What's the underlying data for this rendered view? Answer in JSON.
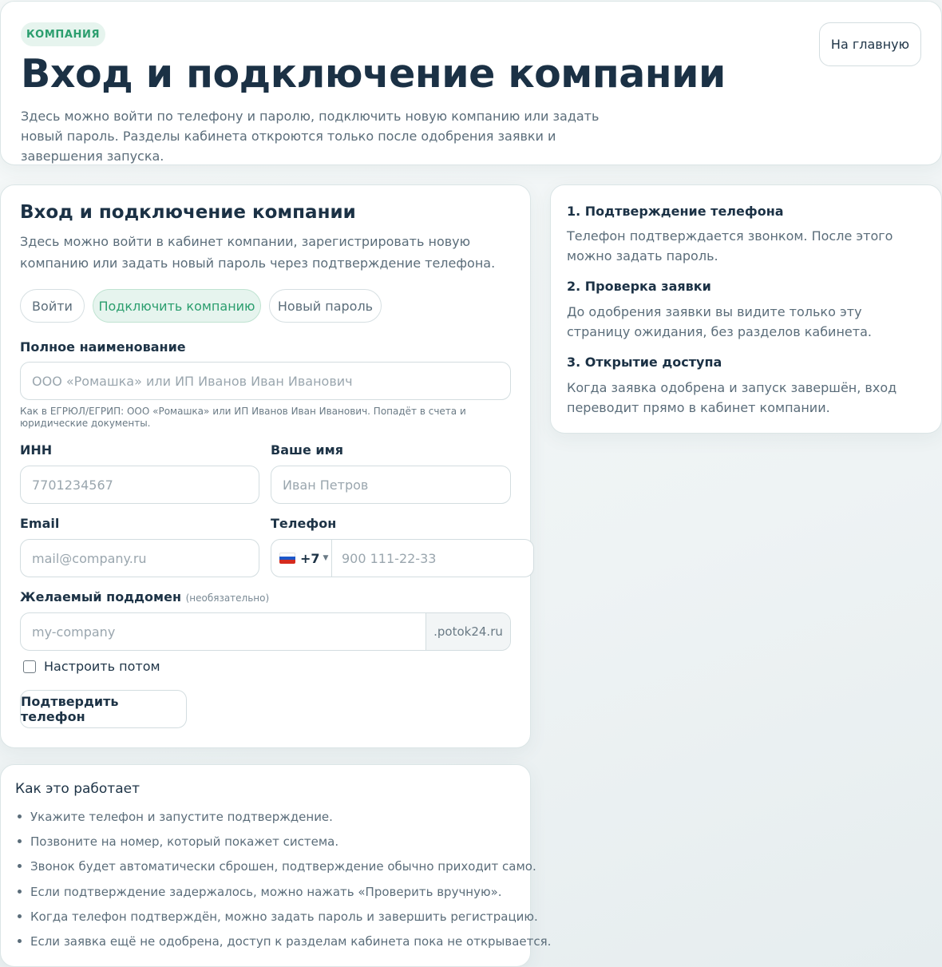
{
  "header": {
    "badge": "КОМПАНИЯ",
    "title": "Вход и подключение компании",
    "description": "Здесь можно войти по телефону и паролю, подключить новую компанию или задать новый пароль. Разделы кабинета откроются только после одобрения заявки и завершения запуска.",
    "home_button": "На главную"
  },
  "form": {
    "title": "Вход и подключение компании",
    "description": "Здесь можно войти в кабинет компании, зарегистрировать новую компанию или задать новый пароль через подтверждение телефона.",
    "tabs": [
      {
        "label": "Войти",
        "active": false
      },
      {
        "label": "Подключить компанию",
        "active": true
      },
      {
        "label": "Новый пароль",
        "active": false
      }
    ],
    "fullname": {
      "label": "Полное наименование",
      "placeholder": "ООО «Ромашка» или ИП Иванов Иван Иванович",
      "hint": "Как в ЕГРЮЛ/ЕГРИП: ООО «Ромашка» или ИП Иванов Иван Иванович. Попадёт в счета и юридические документы."
    },
    "inn": {
      "label": "ИНН",
      "placeholder": "7701234567"
    },
    "name": {
      "label": "Ваше имя",
      "placeholder": "Иван Петров"
    },
    "email": {
      "label": "Email",
      "placeholder": "mail@company.ru"
    },
    "phone": {
      "label": "Телефон",
      "code": "+7",
      "placeholder": "900 111-22-33"
    },
    "subdomain": {
      "label": "Желаемый поддомен",
      "optional": "(необязательно)",
      "placeholder": "my-company",
      "suffix": ".potok24.ru"
    },
    "later_checkbox": {
      "label": "Настроить потом",
      "checked": false
    },
    "submit": "Подтвердить телефон"
  },
  "steps": [
    {
      "title": "1. Подтверждение телефона",
      "text": "Телефон подтверждается звонком. После этого можно задать пароль."
    },
    {
      "title": "2. Проверка заявки",
      "text": "До одобрения заявки вы видите только эту страницу ожидания, без разделов кабинета."
    },
    {
      "title": "3. Открытие доступа",
      "text": "Когда заявка одобрена и запуск завершён, вход переводит прямо в кабинет компании."
    }
  ],
  "how": {
    "title": "Как это работает",
    "items": [
      "Укажите телефон и запустите подтверждение.",
      "Позвоните на номер, который покажет система.",
      "Звонок будет автоматически сброшен, подтверждение обычно приходит само.",
      "Если подтверждение задержалось, можно нажать «Проверить вручную».",
      "Когда телефон подтверждён, можно задать пароль и завершить регистрацию.",
      "Если заявка ещё не одобрена, доступ к разделам кабинета пока не открывается."
    ]
  },
  "colors": {
    "accent": "#2b9e6e",
    "accent_bg": "#e6f4ee",
    "text": "#1d3346",
    "muted": "#5b6d7a"
  }
}
